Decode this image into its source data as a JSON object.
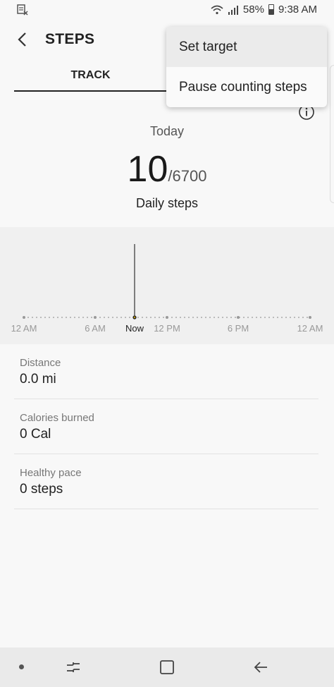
{
  "status_bar": {
    "battery": "58%",
    "time": "9:38 AM"
  },
  "app_bar": {
    "title": "STEPS"
  },
  "tabs": [
    {
      "label": "TRACK",
      "active": true
    }
  ],
  "summary": {
    "period": "Today",
    "steps": "10",
    "target": "/6700",
    "label": "Daily steps"
  },
  "chart_data": {
    "type": "bar",
    "x_tick_labels": [
      "12 AM",
      "6 AM",
      "Now",
      "12 PM",
      "6 PM",
      "12 AM"
    ],
    "current_marker": "Now",
    "steps_now": 10
  },
  "stats": [
    {
      "label": "Distance",
      "value": "0.0 mi"
    },
    {
      "label": "Calories burned",
      "value": "0 Cal"
    },
    {
      "label": "Healthy pace",
      "value": "0 steps"
    }
  ],
  "menu": {
    "items": [
      "Set target",
      "Pause counting steps"
    ]
  },
  "colors": {
    "accent": "#222222",
    "chart_bg": "#f0f0f0",
    "now_dot": "#c8a000"
  }
}
